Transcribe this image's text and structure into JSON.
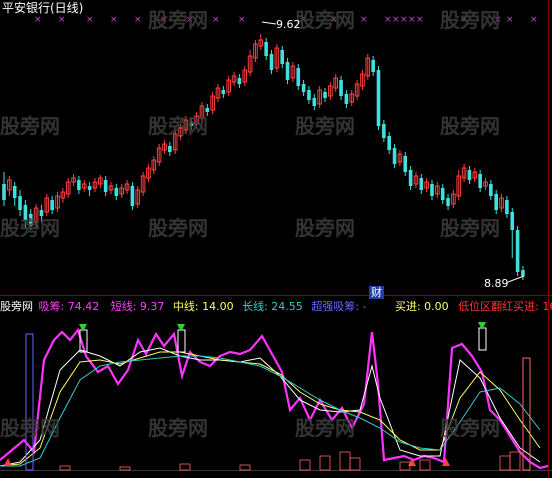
{
  "window": {
    "title": "平安银行(日线)"
  },
  "watermark": "股旁网",
  "price_panel": {
    "high_label": "9.62",
    "low_label": "8.89",
    "event_tag": "财"
  },
  "indicator_panel": {
    "name": "股旁网",
    "items": [
      {
        "label": "吸筹: 74.42",
        "color": "#ff3fff"
      },
      {
        "label": "短线: 9.37",
        "color": "#ff3fff"
      },
      {
        "label": "中线: 14.00",
        "color": "#ffff66"
      },
      {
        "label": "长线: 24.55",
        "color": "#33cccc"
      },
      {
        "label": "超强吸筹: -",
        "color": "#6666ff"
      },
      {
        "label": "买进: 0.00",
        "color": "#ffff66"
      },
      {
        "label": "低位区翻红买进: 16",
        "color": "#ff3333"
      }
    ]
  },
  "colors": {
    "up": "#ff4040",
    "down": "#40e0e0",
    "grid": "#8b0000",
    "purple_marks": "#cc44cc",
    "magenta": "#ff33ff",
    "yellow": "#ffff66",
    "cyan": "#33cccc",
    "white": "#ffffff"
  }
}
